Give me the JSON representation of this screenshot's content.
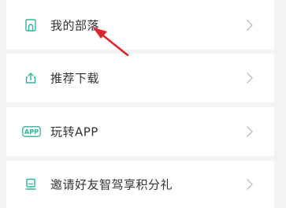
{
  "menu": {
    "items": [
      {
        "label": "我的部落",
        "icon": "house-icon"
      },
      {
        "label": "推荐下载",
        "icon": "share-upload-icon"
      },
      {
        "label": "玩转APP",
        "icon": "app-badge-icon",
        "badge_text": "APP"
      },
      {
        "label": "邀请好友智驾享积分礼",
        "icon": "invite-gift-icon"
      }
    ]
  },
  "colors": {
    "icon_teal": "#2fb39a",
    "arrow_red": "#e0252a",
    "chevron": "#c8c8c8",
    "text": "#333333"
  }
}
